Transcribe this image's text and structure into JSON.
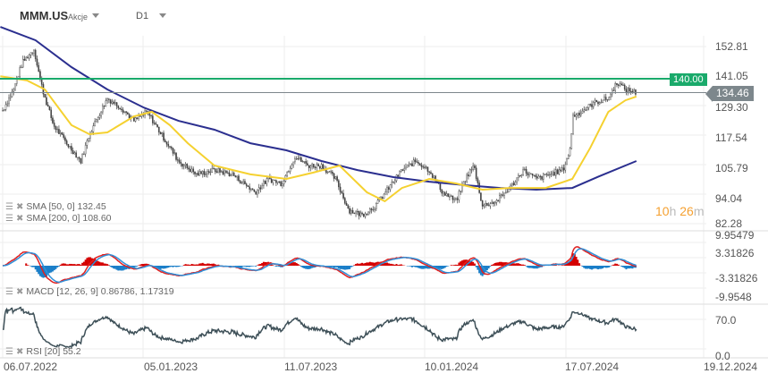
{
  "header": {
    "symbol": "MMM.US",
    "type": "Akcje",
    "timeframe": "D1"
  },
  "price_axis": [
    "152.81",
    "141.05",
    "129.30",
    "117.54",
    "105.79",
    "94.04",
    "82.28"
  ],
  "macd_axis": [
    "9.95479",
    "3.31826",
    "-3.31826",
    "-9.9548"
  ],
  "rsi_axis": [
    "70.0",
    "0.0"
  ],
  "date_axis": [
    "06.07.2022",
    "05.01.2023",
    "11.07.2023",
    "10.01.2024",
    "17.07.2024",
    "19.12.2024"
  ],
  "level_line": {
    "label": "140.00",
    "value": 140.0,
    "color": "#1aaa6b"
  },
  "current_price": {
    "label": "134.46",
    "value": 134.46,
    "color": "#7d878c"
  },
  "countdown": {
    "h": "10",
    "h_unit": "h",
    "m": "26",
    "m_unit": "m"
  },
  "legends": {
    "sma50": "SMA [50, 0] 132.45",
    "sma200": "SMA [200, 0] 108.60",
    "macd": "MACD [12, 26, 9] 0.86786,  1.17319",
    "rsi": "RSI [20] 55.2"
  },
  "colors": {
    "sma50": "#f5d130",
    "sma200": "#2b2f8f",
    "macd": "#e02020",
    "signal": "#3090d8",
    "hist_pos": "#d40000",
    "hist_neg": "#1a7ec8",
    "rsi": "#3e5058",
    "grid": "#eeeeee"
  },
  "chart_data": {
    "type": "line",
    "title": "MMM.US D1",
    "x_unit": "days since 06.07.2022",
    "ylim": [
      82.28,
      152.81
    ],
    "price": [
      [
        2,
        128.6
      ],
      [
        14,
        135.7
      ],
      [
        25,
        146.4
      ],
      [
        40,
        151.7
      ],
      [
        51,
        135.7
      ],
      [
        65,
        121.5
      ],
      [
        82,
        114.3
      ],
      [
        100,
        107.2
      ],
      [
        111,
        117.9
      ],
      [
        122,
        125.0
      ],
      [
        134,
        132.1
      ],
      [
        151,
        128.6
      ],
      [
        168,
        123.2
      ],
      [
        185,
        126.8
      ],
      [
        203,
        117.9
      ],
      [
        225,
        107.2
      ],
      [
        248,
        101.9
      ],
      [
        271,
        103.6
      ],
      [
        294,
        101.9
      ],
      [
        323,
        94.8
      ],
      [
        340,
        100.1
      ],
      [
        357,
        98.3
      ],
      [
        374,
        109.0
      ],
      [
        391,
        105.4
      ],
      [
        408,
        105.4
      ],
      [
        426,
        100.1
      ],
      [
        443,
        87.6
      ],
      [
        460,
        85.8
      ],
      [
        477,
        89.4
      ],
      [
        494,
        96.5
      ],
      [
        511,
        103.6
      ],
      [
        529,
        107.2
      ],
      [
        546,
        103.6
      ],
      [
        563,
        94.8
      ],
      [
        580,
        91.2
      ],
      [
        592,
        100.1
      ],
      [
        603,
        105.4
      ],
      [
        614,
        89.4
      ],
      [
        632,
        91.2
      ],
      [
        649,
        96.5
      ],
      [
        666,
        103.6
      ],
      [
        683,
        100.1
      ],
      [
        700,
        101.9
      ],
      [
        717,
        103.6
      ],
      [
        727,
        112.5
      ],
      [
        729,
        125.0
      ],
      [
        740,
        126.8
      ],
      [
        757,
        130.4
      ],
      [
        775,
        132.1
      ],
      [
        786,
        138.6
      ],
      [
        797,
        135.7
      ],
      [
        811,
        134.46
      ]
    ],
    "sma50": [
      [
        -3,
        141.0
      ],
      [
        31,
        139.3
      ],
      [
        54,
        135.7
      ],
      [
        88,
        121.5
      ],
      [
        111,
        117.9
      ],
      [
        134,
        118.6
      ],
      [
        168,
        125.0
      ],
      [
        191,
        126.8
      ],
      [
        214,
        121.5
      ],
      [
        237,
        114.3
      ],
      [
        271,
        105.4
      ],
      [
        317,
        101.9
      ],
      [
        363,
        100.1
      ],
      [
        397,
        102.6
      ],
      [
        431,
        105.4
      ],
      [
        466,
        94.8
      ],
      [
        489,
        91.2
      ],
      [
        511,
        96.5
      ],
      [
        546,
        100.1
      ],
      [
        580,
        98.3
      ],
      [
        614,
        95.8
      ],
      [
        649,
        96.5
      ],
      [
        695,
        96.5
      ],
      [
        729,
        100.1
      ],
      [
        752,
        112.5
      ],
      [
        775,
        126.8
      ],
      [
        797,
        131.4
      ],
      [
        811,
        132.9
      ]
    ],
    "sma200": [
      [
        -3,
        160.6
      ],
      [
        42,
        155.3
      ],
      [
        88,
        144.6
      ],
      [
        134,
        135.7
      ],
      [
        180,
        128.6
      ],
      [
        225,
        123.2
      ],
      [
        271,
        119.7
      ],
      [
        317,
        114.3
      ],
      [
        363,
        111.5
      ],
      [
        408,
        107.2
      ],
      [
        454,
        103.6
      ],
      [
        500,
        100.8
      ],
      [
        546,
        99.0
      ],
      [
        592,
        97.6
      ],
      [
        637,
        96.5
      ],
      [
        683,
        95.8
      ],
      [
        729,
        96.5
      ],
      [
        763,
        101.1
      ],
      [
        811,
        107.2
      ]
    ],
    "macd_ylim": [
      -9.9548,
      9.95479
    ],
    "rsi_ylim": [
      0,
      100
    ]
  }
}
